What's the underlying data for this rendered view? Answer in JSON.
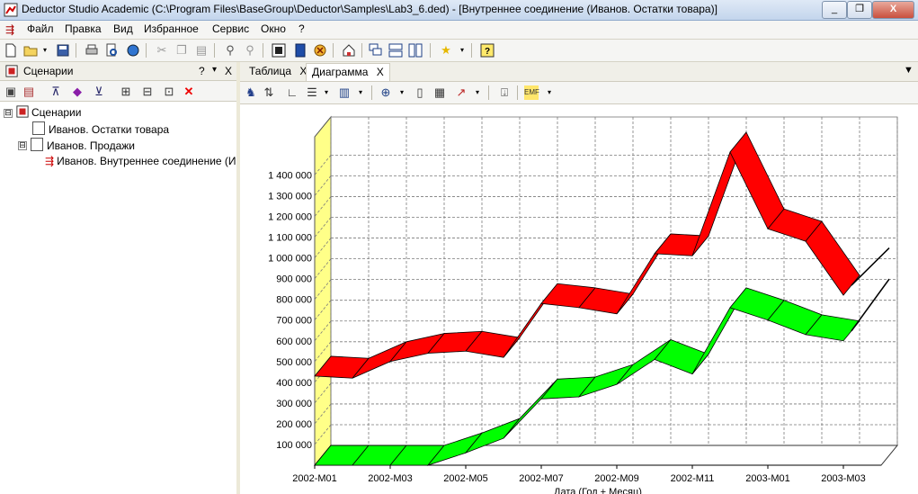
{
  "window": {
    "title": "Deductor Studio Academic (C:\\Program Files\\BaseGroup\\Deductor\\Samples\\Lab3_6.ded) - [Внутреннее соединение (Иванов. Остатки товара)]",
    "controls": [
      "_",
      "❐",
      "X"
    ]
  },
  "menu": {
    "items": [
      "Файл",
      "Правка",
      "Вид",
      "Избранное",
      "Сервис",
      "Окно",
      "?"
    ]
  },
  "mdi_controls": [
    "_",
    "❐",
    "x"
  ],
  "toolbar": {
    "icons": [
      "new-icon",
      "open-icon",
      "save-icon",
      "print-icon",
      "preview-icon",
      "globe-icon",
      "cut-icon",
      "copy-icon",
      "paste-icon",
      "find-icon",
      "find-next-icon",
      "wizard-icon",
      "report-icon",
      "stop-icon",
      "home-icon",
      "cascade-icon",
      "tile-h-icon",
      "tile-v-icon",
      "favorites-icon",
      "help-icon"
    ]
  },
  "scenarios_panel": {
    "title": "Сценарии",
    "controls": [
      "?",
      "▾",
      "X"
    ],
    "tree": [
      {
        "label": "Сценарии",
        "level": 0,
        "expander": "⊟"
      },
      {
        "label": "Иванов. Остатки товара",
        "level": 1,
        "expander": ""
      },
      {
        "label": "Иванов. Продажи",
        "level": 1,
        "expander": "⊟"
      },
      {
        "label": "Иванов. Внутреннее соединение (Ива",
        "level": 2,
        "expander": ""
      }
    ]
  },
  "tabs": [
    {
      "label": "Таблица",
      "close": "X"
    },
    {
      "label": "Диаграмма",
      "close": "X"
    }
  ],
  "tab_dropdown": "▼",
  "chart_data": {
    "type": "line",
    "title": "",
    "xlabel": "Дата (Год + Месяц)",
    "ylabel": "",
    "ylim": [
      0,
      1500000
    ],
    "yticks": [
      "100 000",
      "200 000",
      "300 000",
      "400 000",
      "500 000",
      "600 000",
      "700 000",
      "800 000",
      "900 000",
      "1 000 000",
      "1 100 000",
      "1 200 000",
      "1 300 000",
      "1 400 000"
    ],
    "x": [
      "2002-M01",
      "2002-M02",
      "2002-M03",
      "2002-M04",
      "2002-M05",
      "2002-M06",
      "2002-M07",
      "2002-M08",
      "2002-M09",
      "2002-M10",
      "2002-M11",
      "2002-M12",
      "2003-M01",
      "2003-M02",
      "2003-M03",
      "2003-M04"
    ],
    "xtick_labels": [
      "2002-M01",
      "2002-M03",
      "2002-M05",
      "2002-M07",
      "2002-M09",
      "2002-M11",
      "2003-M01",
      "2003-M03"
    ],
    "series": [
      {
        "name": "",
        "color": "#ff0000",
        "values": [
          430000,
          420000,
          500000,
          540000,
          550000,
          520000,
          780000,
          760000,
          730000,
          1020000,
          1010000,
          1510000,
          1140000,
          1080000,
          820000,
          1000000
        ]
      },
      {
        "name": "",
        "color": "#00ff00",
        "values": [
          0,
          0,
          0,
          0,
          60000,
          130000,
          320000,
          330000,
          390000,
          510000,
          440000,
          760000,
          700000,
          630000,
          600000,
          850000
        ]
      }
    ],
    "grid": true,
    "wall_color": "#ffff88"
  }
}
